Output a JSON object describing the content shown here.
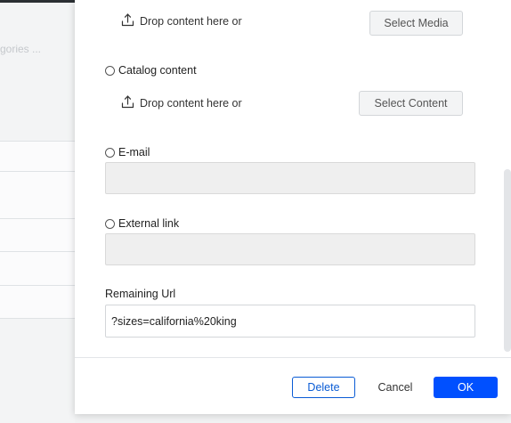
{
  "background": {
    "search_placeholder": "gories ..."
  },
  "media": {
    "drop_text": "Drop content here or",
    "select_button": "Select Media"
  },
  "catalog": {
    "label": "Catalog content",
    "drop_text": "Drop content here or",
    "select_button": "Select Content"
  },
  "email": {
    "label": "E-mail",
    "value": ""
  },
  "external_link": {
    "label": "External link",
    "value": ""
  },
  "remaining_url": {
    "label": "Remaining Url",
    "value": "?sizes=california%20king"
  },
  "footer": {
    "delete_label": "Delete",
    "cancel_label": "Cancel",
    "ok_label": "OK"
  },
  "colors": {
    "primary": "#0050ff",
    "outline": "#0a5cd5",
    "disabled_fill": "#efefef"
  }
}
